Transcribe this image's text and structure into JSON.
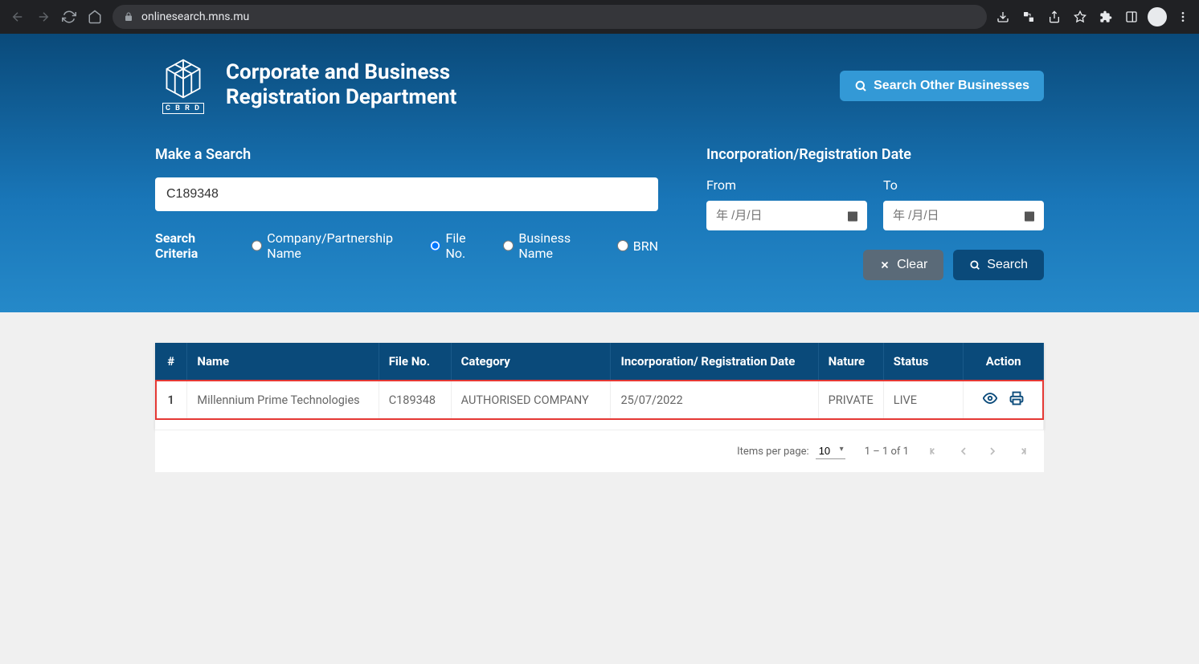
{
  "browser": {
    "url": "onlinesearch.mns.mu"
  },
  "header": {
    "logo_label": "C B R D",
    "title_line1": "Corporate and Business",
    "title_line2": "Registration Department",
    "search_other_btn": "Search Other Businesses"
  },
  "form": {
    "make_search_label": "Make a Search",
    "search_value": "C189348",
    "criteria_label": "Search Criteria",
    "criteria_options": {
      "company_name": "Company/Partnership Name",
      "file_no": "File No.",
      "business_name": "Business Name",
      "brn": "BRN"
    },
    "date_section_label": "Incorporation/Registration Date",
    "from_label": "From",
    "to_label": "To",
    "date_placeholder": "年 /月/日",
    "clear_btn": "Clear",
    "search_btn": "Search"
  },
  "table": {
    "headers": {
      "num": "#",
      "name": "Name",
      "file_no": "File No.",
      "category": "Category",
      "inc_date": "Incorporation/ Registration Date",
      "nature": "Nature",
      "status": "Status",
      "action": "Action"
    },
    "rows": [
      {
        "num": "1",
        "name": "Millennium Prime Technologies",
        "file_no": "C189348",
        "category": "AUTHORISED COMPANY",
        "inc_date": "25/07/2022",
        "nature": "PRIVATE",
        "status": "LIVE"
      }
    ]
  },
  "paginator": {
    "items_label": "Items per page:",
    "items_value": "10",
    "range": "1 – 1 of 1"
  }
}
